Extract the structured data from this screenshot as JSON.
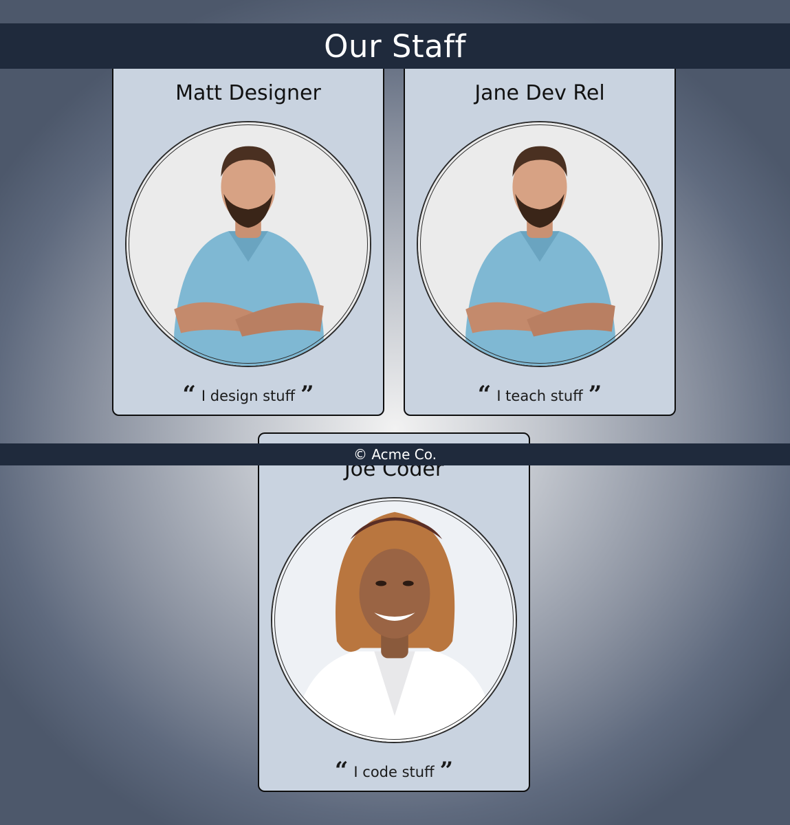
{
  "header": {
    "title": "Our Staff"
  },
  "footer": {
    "text": "© Acme Co."
  },
  "staff": [
    {
      "name": "Matt Designer",
      "quote": "I design stuff",
      "photo_icon": "man-portrait"
    },
    {
      "name": "Jane Dev Rel",
      "quote": "I teach stuff",
      "photo_icon": "man-portrait"
    },
    {
      "name": "Joe Coder",
      "quote": "I code stuff",
      "photo_icon": "woman-portrait"
    }
  ],
  "quote_marks": {
    "open": "“",
    "close": "”"
  },
  "colors": {
    "header_bg": "#1f2a3c",
    "card_bg": "#c9d3e0",
    "card_border": "#0d0d0d",
    "shirt_blue": "#7fb8d3"
  }
}
